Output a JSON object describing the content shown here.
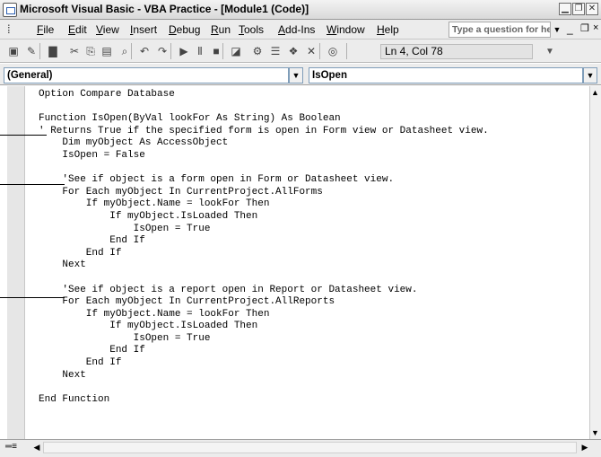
{
  "window": {
    "title": "Microsoft Visual Basic - VBA Practice - [Module1 (Code)]"
  },
  "window_buttons": {
    "minimize": "▁",
    "restore": "❐",
    "close": "✕"
  },
  "menu": {
    "items": [
      "File",
      "Edit",
      "View",
      "Insert",
      "Debug",
      "Run",
      "Tools",
      "Add-Ins",
      "Window",
      "Help"
    ],
    "help_placeholder": "Type a question for help",
    "doc_minimize": "_",
    "doc_restore": "❐",
    "doc_close": "×"
  },
  "toolbar": {
    "icons": [
      "access-view-icon",
      "insert-module-icon",
      "save-icon",
      "cut-icon",
      "copy-icon",
      "paste-icon",
      "find-icon",
      "undo-icon",
      "redo-icon",
      "run-icon",
      "break-icon",
      "reset-icon",
      "design-mode-icon",
      "project-explorer-icon",
      "properties-icon",
      "object-browser-icon",
      "toolbox-icon",
      "help-icon"
    ],
    "glyphs": [
      "▣",
      "✎",
      "▇",
      "✂",
      "⎘",
      "▤",
      "⌕",
      "↶",
      "↷",
      "▶",
      "Ⅱ",
      "■",
      "◪",
      "⚙",
      "☰",
      "❖",
      "✕",
      "◎"
    ],
    "position": "Ln 4, Col 78"
  },
  "combos": {
    "object": "(General)",
    "procedure": "IsOpen"
  },
  "code": {
    "lines": [
      "Option Compare Database",
      "",
      "Function IsOpen(ByVal lookFor As String) As Boolean",
      "' Returns True if the specified form is open in Form view or Datasheet view.",
      "    Dim myObject As AccessObject",
      "    IsOpen = False",
      "",
      "    'See if object is a form open in Form or Datasheet view.",
      "    For Each myObject In CurrentProject.AllForms",
      "        If myObject.Name = lookFor Then",
      "            If myObject.IsLoaded Then",
      "                IsOpen = True",
      "            End If",
      "        End If",
      "    Next",
      "",
      "    'See if object is a report open in Report or Datasheet view.",
      "    For Each myObject In CurrentProject.AllReports",
      "        If myObject.Name = lookFor Then",
      "            If myObject.IsLoaded Then",
      "                IsOpen = True",
      "            End If",
      "        End If",
      "    Next",
      "",
      "End Function"
    ]
  },
  "scroll": {
    "up": "▲",
    "down": "▼",
    "left": "◀",
    "right": "▶"
  },
  "view_buttons": "═≡"
}
